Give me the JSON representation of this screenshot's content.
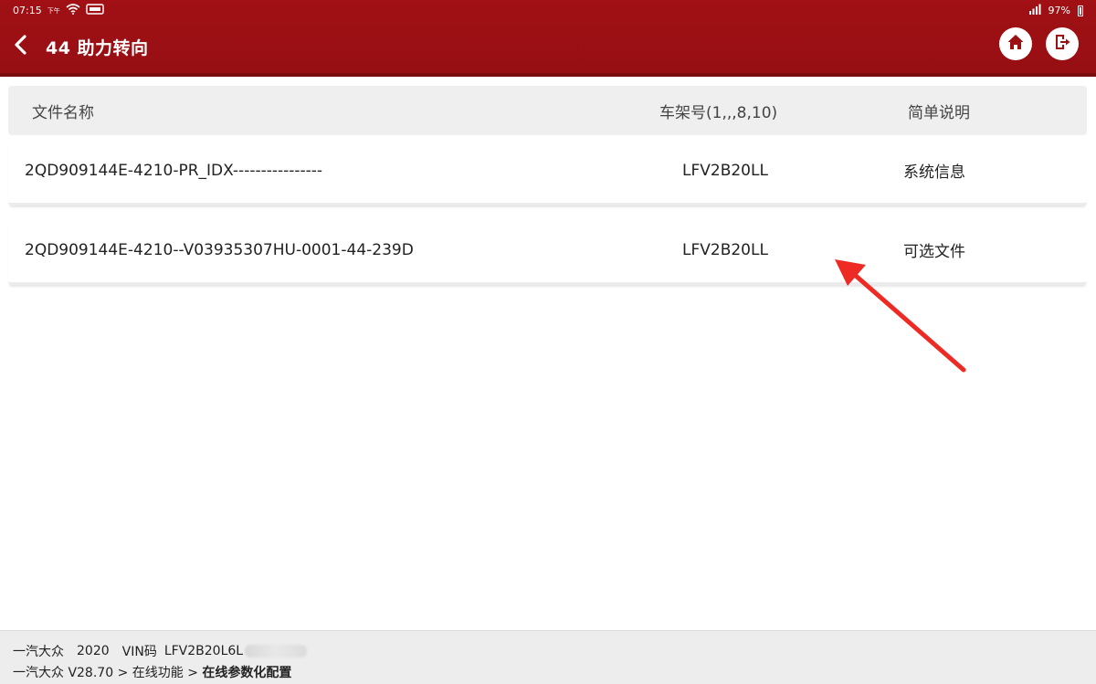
{
  "status_bar": {
    "time": "07:15",
    "ampm": "下午",
    "battery": "97%"
  },
  "header": {
    "title": "44 助力转向",
    "icons": {
      "back": "chevron-left-icon",
      "home": "home-icon",
      "exit": "exit-icon"
    },
    "colors": {
      "background": "#9c1014",
      "text": "#ffffff"
    }
  },
  "table": {
    "columns": [
      "文件名称",
      "车架号(1,,,8,10)",
      "简单说明"
    ],
    "rows": [
      {
        "file_name": "2QD909144E-4210-PR_IDX----------------",
        "vin": "LFV2B20LL",
        "description": "系统信息"
      },
      {
        "file_name": "2QD909144E-4210--V03935307HU-0001-44-239D",
        "vin": "LFV2B20LL",
        "description": "可选文件"
      }
    ]
  },
  "annotation": {
    "color": "#ee2a24"
  },
  "footer": {
    "brand": "一汽大众",
    "year": "2020",
    "vin_label": "VIN码",
    "vin_value": "LFV2B20L6L",
    "breadcrumb": {
      "root": "一汽大众 V28.70",
      "sep": ">",
      "level1": "在线功能",
      "current": "在线参数化配置"
    }
  }
}
